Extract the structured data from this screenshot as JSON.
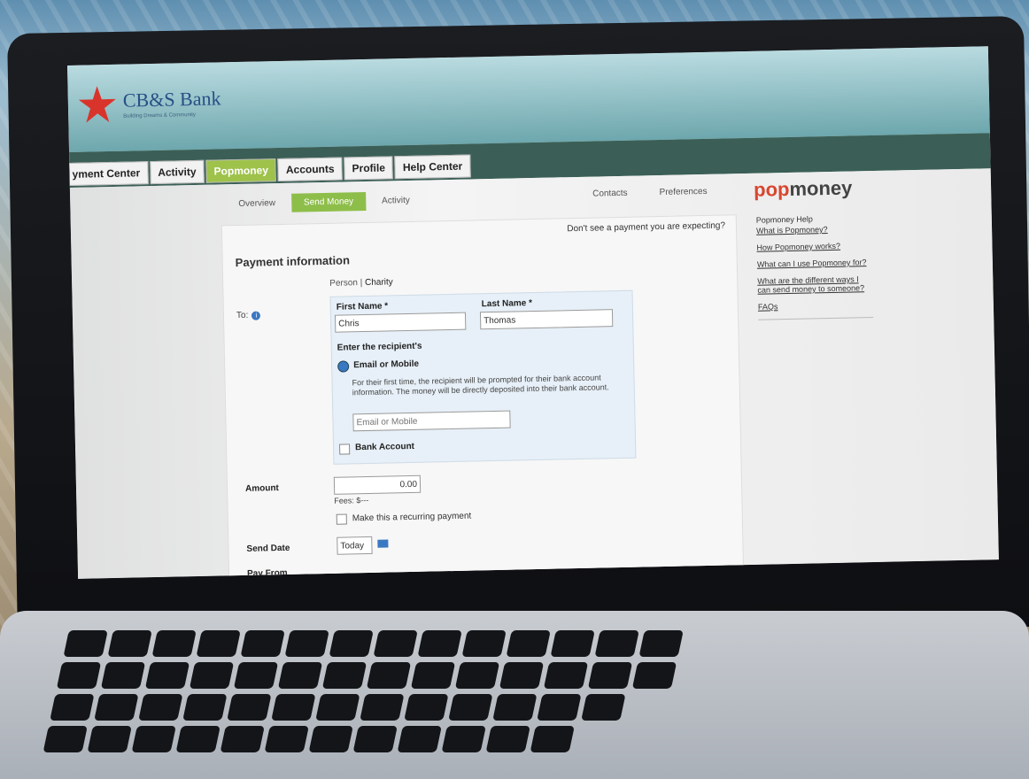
{
  "bank": {
    "name": "CB&S Bank",
    "tagline": "Building Dreams & Community"
  },
  "nav": {
    "tabs": [
      {
        "label": "yment Center"
      },
      {
        "label": "Activity"
      },
      {
        "label": "Popmoney"
      },
      {
        "label": "Accounts"
      },
      {
        "label": "Profile"
      },
      {
        "label": "Help Center"
      }
    ]
  },
  "subnav": {
    "tabs": [
      {
        "label": "Overview"
      },
      {
        "label": "Send Money"
      },
      {
        "label": "Activity"
      }
    ],
    "right": {
      "contacts": "Contacts",
      "preferences": "Preferences"
    }
  },
  "brand": {
    "pop": "pop",
    "money": "money"
  },
  "form": {
    "expect_link": "Don't see a payment you are expecting?",
    "title": "Payment information",
    "person_label": "Person",
    "charity_label": "Charity",
    "to_label": "To:",
    "first_name_label": "First Name *",
    "first_name_value": "Chris",
    "last_name_label": "Last Name *",
    "last_name_value": "Thomas",
    "enter_recipient": "Enter the recipient's",
    "email_option": "Email or Mobile",
    "email_desc": "For their first time, the recipient will be prompted for their bank account information. The money will be directly deposited into their bank account.",
    "email_placeholder": "Email or Mobile",
    "bank_option": "Bank Account",
    "amount_label": "Amount",
    "amount_value": "0.00",
    "fees_label": "Fees: $---",
    "recurring_label": "Make this a recurring payment",
    "send_date_label": "Send Date",
    "send_date_value": "Today",
    "pay_from_label": "Pay From"
  },
  "sidebar": {
    "title": "Popmoney Help",
    "links": [
      "What is Popmoney?",
      "How Popmoney works?",
      "What can I use Popmoney for?",
      "What are the different ways I can send money to someone?",
      "FAQs"
    ]
  },
  "colors": {
    "accent_green": "#8ebe4a",
    "header_dark": "#3b5f56",
    "pop_red": "#d9462f",
    "link_blue": "#3a78c2"
  }
}
